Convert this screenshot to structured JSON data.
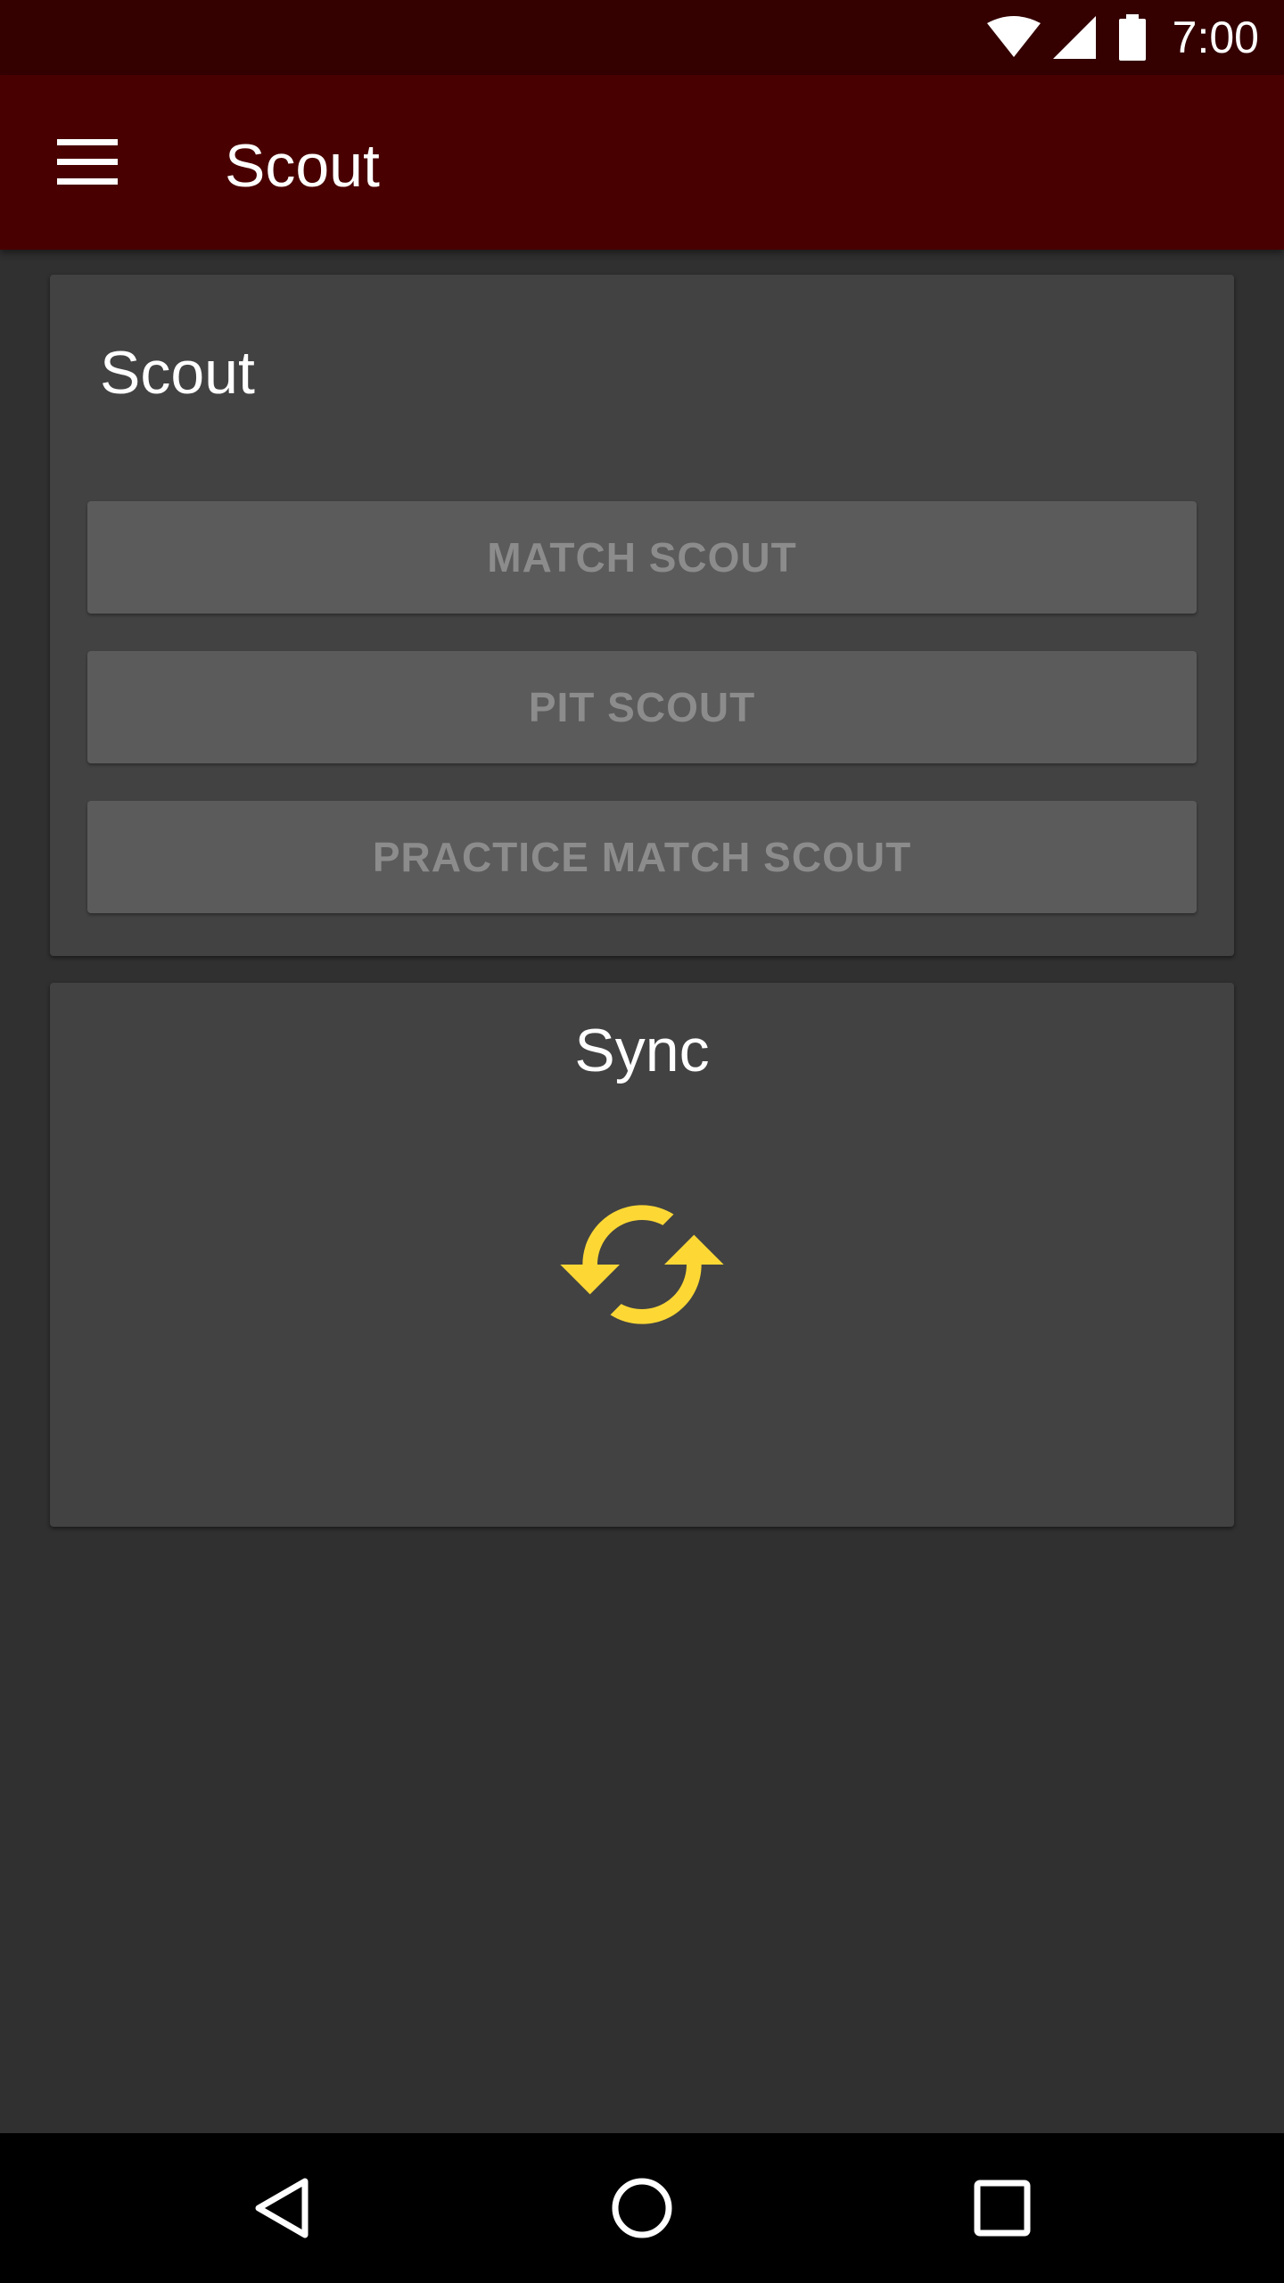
{
  "status_bar": {
    "time": "7:00",
    "icons": [
      "wifi-icon",
      "signal-icon",
      "battery-icon"
    ]
  },
  "app_bar": {
    "title": "Scout",
    "menu_icon": "hamburger-menu-icon"
  },
  "scout_card": {
    "title": "Scout",
    "buttons": [
      {
        "label": "MATCH SCOUT"
      },
      {
        "label": "PIT SCOUT"
      },
      {
        "label": "PRACTICE MATCH SCOUT"
      }
    ]
  },
  "sync_card": {
    "title": "Sync",
    "icon": "sync-icon"
  },
  "nav_bar": {
    "buttons": [
      "back-icon",
      "home-icon",
      "recents-icon"
    ]
  },
  "colors": {
    "status_bar": "#340000",
    "app_bar": "#490000",
    "background": "#303030",
    "card": "#424242",
    "button": "#5b5b5b",
    "button_text": "#8c8c8c",
    "sync_accent": "#fdd835"
  }
}
